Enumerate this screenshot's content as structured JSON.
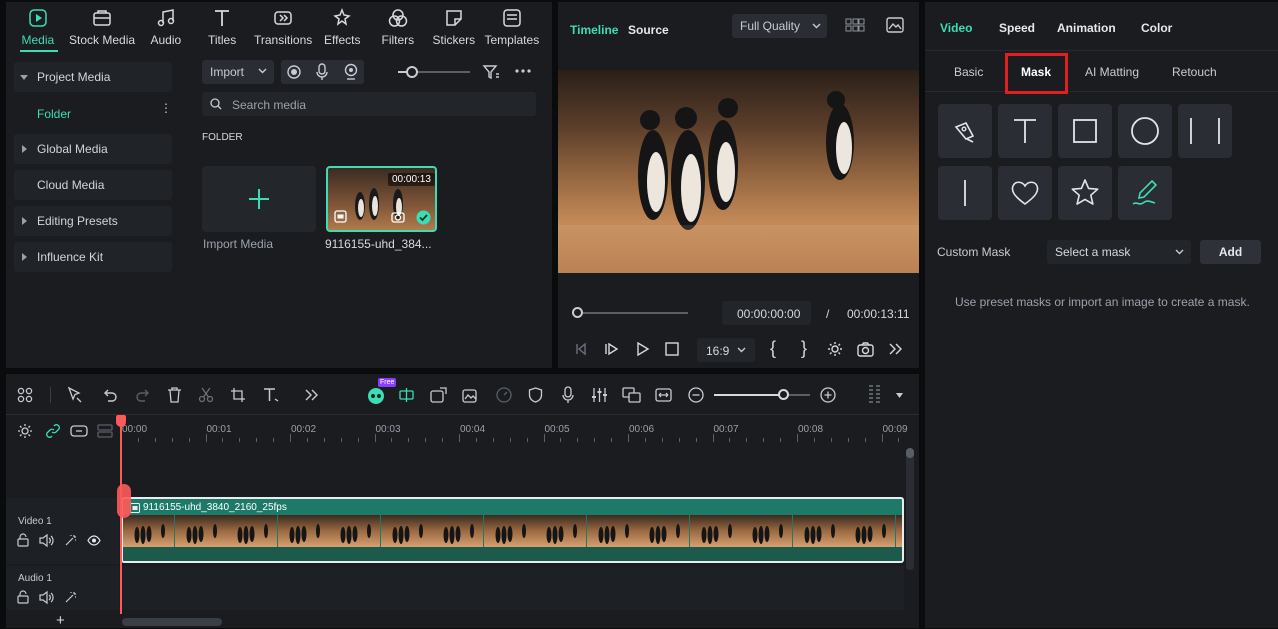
{
  "media_tabs": [
    {
      "label": "Media",
      "icon": "media-icon",
      "active": true
    },
    {
      "label": "Stock Media",
      "icon": "stock-media-icon"
    },
    {
      "label": "Audio",
      "icon": "audio-icon"
    },
    {
      "label": "Titles",
      "icon": "titles-icon"
    },
    {
      "label": "Transitions",
      "icon": "transitions-icon"
    },
    {
      "label": "Effects",
      "icon": "effects-icon"
    },
    {
      "label": "Filters",
      "icon": "filters-icon"
    },
    {
      "label": "Stickers",
      "icon": "stickers-icon"
    },
    {
      "label": "Templates",
      "icon": "templates-icon"
    }
  ],
  "sidebar": {
    "project_media": "Project Media",
    "folder": "Folder",
    "global_media": "Global Media",
    "cloud_media": "Cloud Media",
    "editing_presets": "Editing Presets",
    "influence_kit": "Influence Kit"
  },
  "media_toolbar": {
    "import_label": "Import",
    "search_placeholder": "Search media",
    "folder_heading": "FOLDER"
  },
  "media_items": {
    "import_label": "Import Media",
    "clip_name": "9116155-uhd_384...",
    "clip_duration": "00:00:13"
  },
  "preview": {
    "tabs": [
      "Timeline",
      "Source"
    ],
    "quality": "Full Quality",
    "current_time": "00:00:00:00",
    "separator": "/",
    "total_time": "00:00:13:11",
    "aspect": "16:9",
    "bracket_in": "{",
    "bracket_out": "}",
    "progress": 0
  },
  "right_panel": {
    "tabs": [
      "Video",
      "Speed",
      "Animation",
      "Color"
    ],
    "subtabs": [
      "Basic",
      "Mask",
      "AI Matting",
      "Retouch"
    ],
    "active_subtab": "Mask",
    "highlight_color": "#e02020",
    "custom_mask_label": "Custom Mask",
    "select_placeholder": "Select a mask",
    "add_label": "Add",
    "hint": "Use preset masks or import an image to create a mask.",
    "shapes": [
      "pen-icon",
      "text-mask-icon",
      "rectangle-icon",
      "circle-icon",
      "double-line-icon",
      "single-line-icon",
      "heart-icon",
      "star-icon",
      "brush-icon"
    ]
  },
  "timeline": {
    "free_badge": "Free",
    "ticks": [
      "00:00",
      "00:01",
      "00:02",
      "00:03",
      "00:04",
      "00:05",
      "00:06",
      "00:07",
      "00:08",
      "00:09"
    ],
    "video_track": "Video 1",
    "audio_track": "Audio 1",
    "clip_label": "9116155-uhd_3840_2160_25fps",
    "add_track": "+",
    "zoom_level": 0.72
  },
  "colors": {
    "accent": "#3ddcb4",
    "bg": "#1a1c20",
    "clip": "#1e7a68"
  }
}
